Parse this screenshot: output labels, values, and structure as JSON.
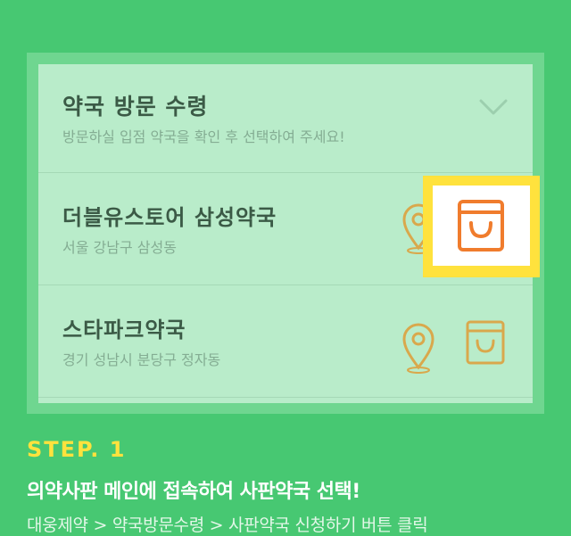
{
  "pickup": {
    "title": "약국 방문 수령",
    "subtitle": "방문하실 입점 약국을 확인 후 선택하여 주세요!",
    "expand_icon": "chevron-down-icon"
  },
  "pharmacies": [
    {
      "name": "더블유스토어 삼성약국",
      "address": "서울 강남구 삼성동",
      "location_icon": "location-pin-icon",
      "select_icon": "shopping-bag-icon",
      "highlighted": true
    },
    {
      "name": "스타파크약국",
      "address": "경기 성남시 분당구 정자동",
      "location_icon": "location-pin-icon",
      "select_icon": "shopping-bag-icon",
      "highlighted": false
    }
  ],
  "guide": {
    "step": "STEP. 1",
    "headline": "의약사판 메인에 접속하여 사판약국 선택!",
    "description": "대웅제약 > 약국방문수령 > 사판약국 신청하기 버튼 클릭"
  },
  "colors": {
    "background": "#47c872",
    "highlight": "#ffe23d",
    "bag_active": "#f07c2d",
    "icon_muted": "#d9a84c"
  }
}
